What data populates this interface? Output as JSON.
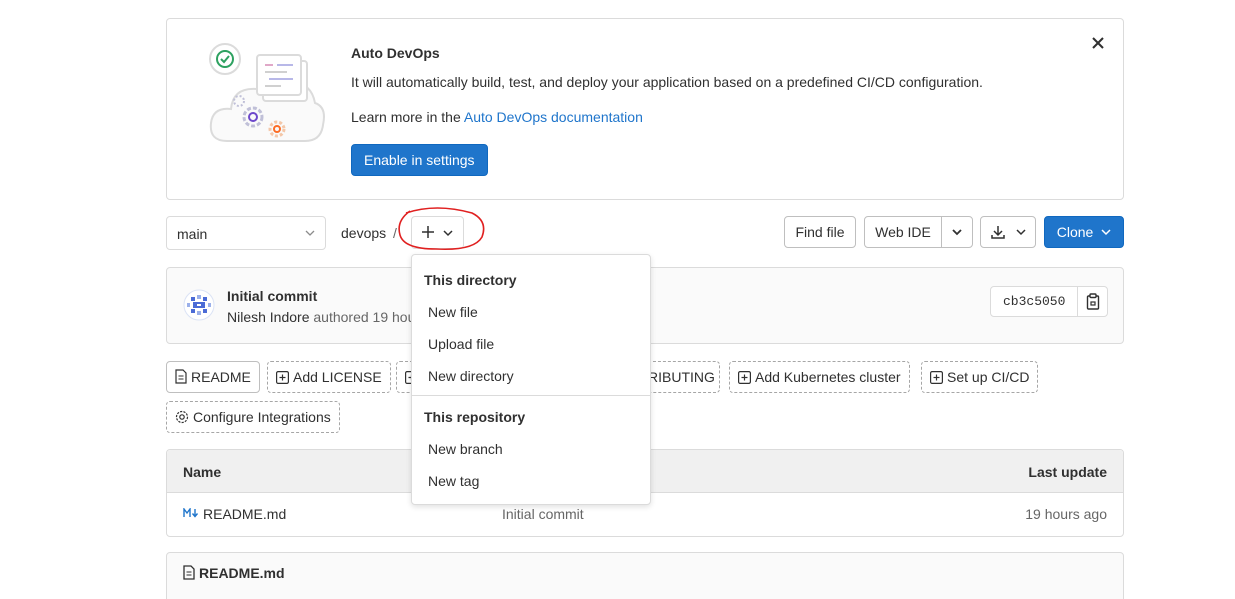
{
  "banner": {
    "title": "Auto DevOps",
    "description": "It will automatically build, test, and deploy your application based on a predefined CI/CD configuration.",
    "learn_prefix": "Learn more in the ",
    "learn_link": "Auto DevOps documentation",
    "enable_button": "Enable in settings",
    "close_icon": "close-icon"
  },
  "repo_nav": {
    "branch": "main",
    "breadcrumb": "devops",
    "separator": "/",
    "find_file": "Find file",
    "web_ide": "Web IDE",
    "clone": "Clone"
  },
  "add_dropdown": {
    "section1_header": "This directory",
    "section1_items": [
      "New file",
      "Upload file",
      "New directory"
    ],
    "section2_header": "This repository",
    "section2_items": [
      "New branch",
      "New tag"
    ]
  },
  "commit": {
    "title": "Initial commit",
    "author": "Nilesh Indore",
    "meta_suffix": " authored 19 hou",
    "sha": "cb3c5050"
  },
  "shortcuts": {
    "readme": "README",
    "add_license": "Add LICENSE",
    "contributing_fragment": "RIBUTING",
    "add_kubernetes": "Add Kubernetes cluster",
    "setup_cicd": "Set up CI/CD",
    "configure_integrations": "Configure Integrations"
  },
  "file_table": {
    "col_name": "Name",
    "col_last_update": "Last update",
    "rows": [
      {
        "name": "README.md",
        "commit": "Initial commit",
        "updated": "19 hours ago"
      }
    ]
  },
  "readme_panel": {
    "title": "README.md"
  },
  "colors": {
    "accent": "#1f75cb",
    "annotation": "#e02020"
  }
}
